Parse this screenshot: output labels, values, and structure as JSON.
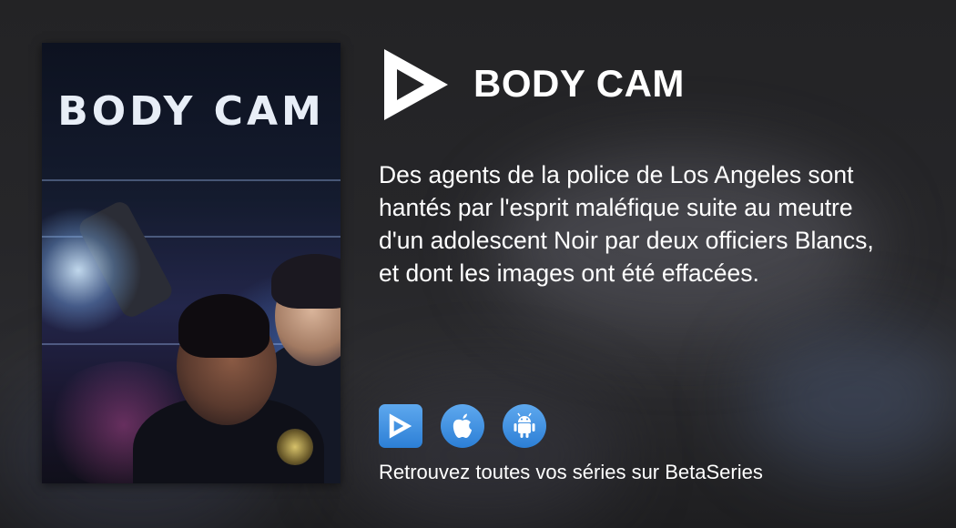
{
  "header": {
    "title": "BODY CAM",
    "logo_icon": "betaseries-play-logo-icon"
  },
  "poster": {
    "title": "BODY CAM"
  },
  "description": "Des agents de la police de Los Angeles sont hantés par l'esprit maléfique suite au meutre d'un adolescent Noir par deux officiers Blancs, et dont les images ont été effacées.",
  "apps": [
    {
      "name": "betaseries-app",
      "icon": "betaseries-icon"
    },
    {
      "name": "apple-app",
      "icon": "apple-icon"
    },
    {
      "name": "android-app",
      "icon": "android-icon"
    }
  ],
  "footer": {
    "tagline": "Retrouvez toutes vos séries sur BetaSeries"
  },
  "colors": {
    "background": "#232325",
    "accent": "#3a8de0",
    "text": "#ffffff"
  }
}
